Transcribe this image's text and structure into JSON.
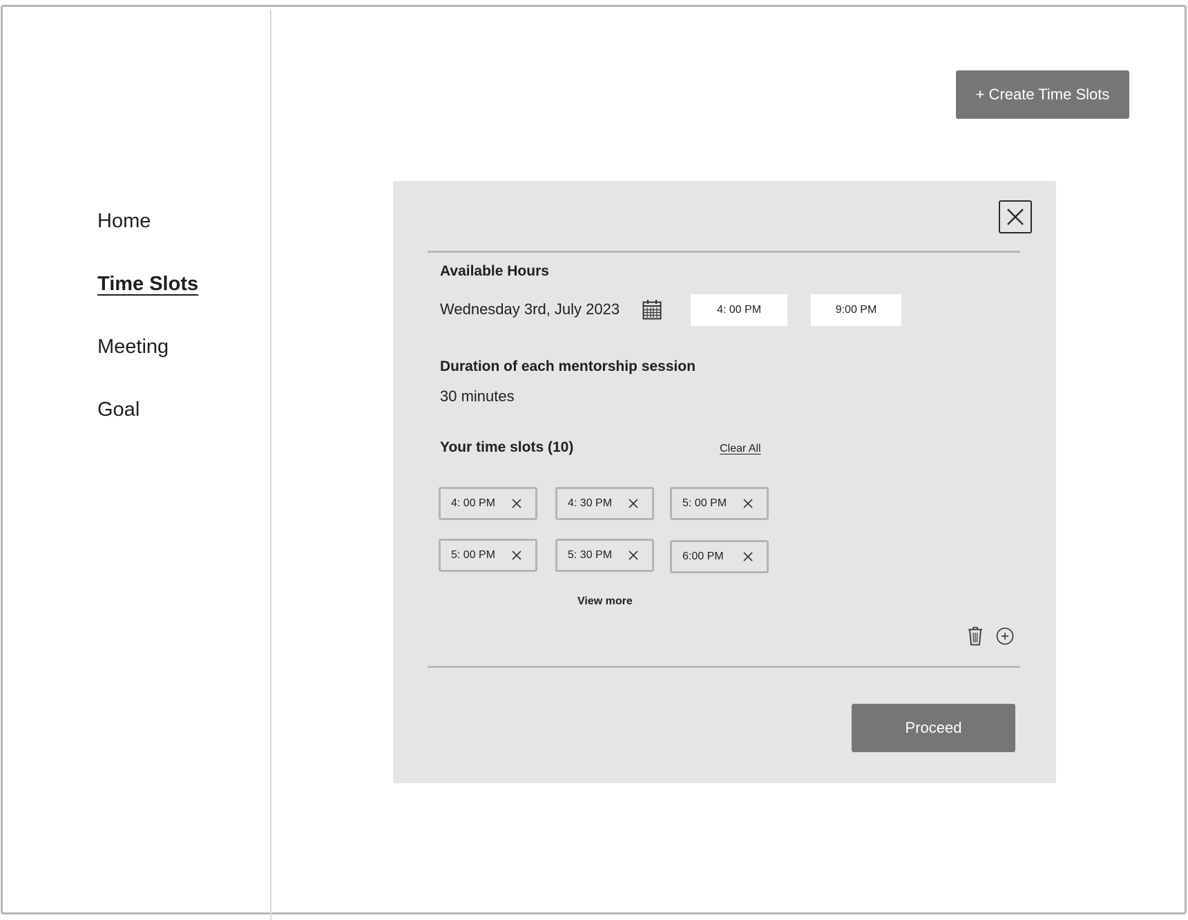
{
  "sidebar": {
    "items": [
      {
        "label": "Home",
        "active": false
      },
      {
        "label": "Time Slots",
        "active": true
      },
      {
        "label": "Meeting",
        "active": false
      },
      {
        "label": "Goal",
        "active": false
      }
    ]
  },
  "header": {
    "create_button_label": "+ Create Time Slots"
  },
  "modal": {
    "close_icon": "close-icon",
    "available_hours": {
      "title": "Available Hours",
      "date": "Wednesday 3rd, July 2023",
      "calendar_icon": "calendar-icon",
      "start_time": "4: 00 PM",
      "end_time": "9:00 PM"
    },
    "duration": {
      "title": "Duration of each mentorship session",
      "value": "30 minutes"
    },
    "slots": {
      "title": "Your time slots (10)",
      "clear_all_label": "Clear All",
      "items": [
        {
          "label": "4: 00 PM"
        },
        {
          "label": "4: 30 PM"
        },
        {
          "label": "5: 00 PM"
        },
        {
          "label": "5: 00 PM"
        },
        {
          "label": "5: 30 PM"
        },
        {
          "label": "6:00 PM"
        }
      ],
      "view_more_label": "View more",
      "delete_icon": "trash-icon",
      "add_icon": "plus-circle-icon"
    },
    "proceed_label": "Proceed"
  },
  "colors": {
    "button_bg": "#767676",
    "modal_bg": "#e5e5e5",
    "border": "#b4b4b4",
    "text": "#1f1f1f"
  }
}
